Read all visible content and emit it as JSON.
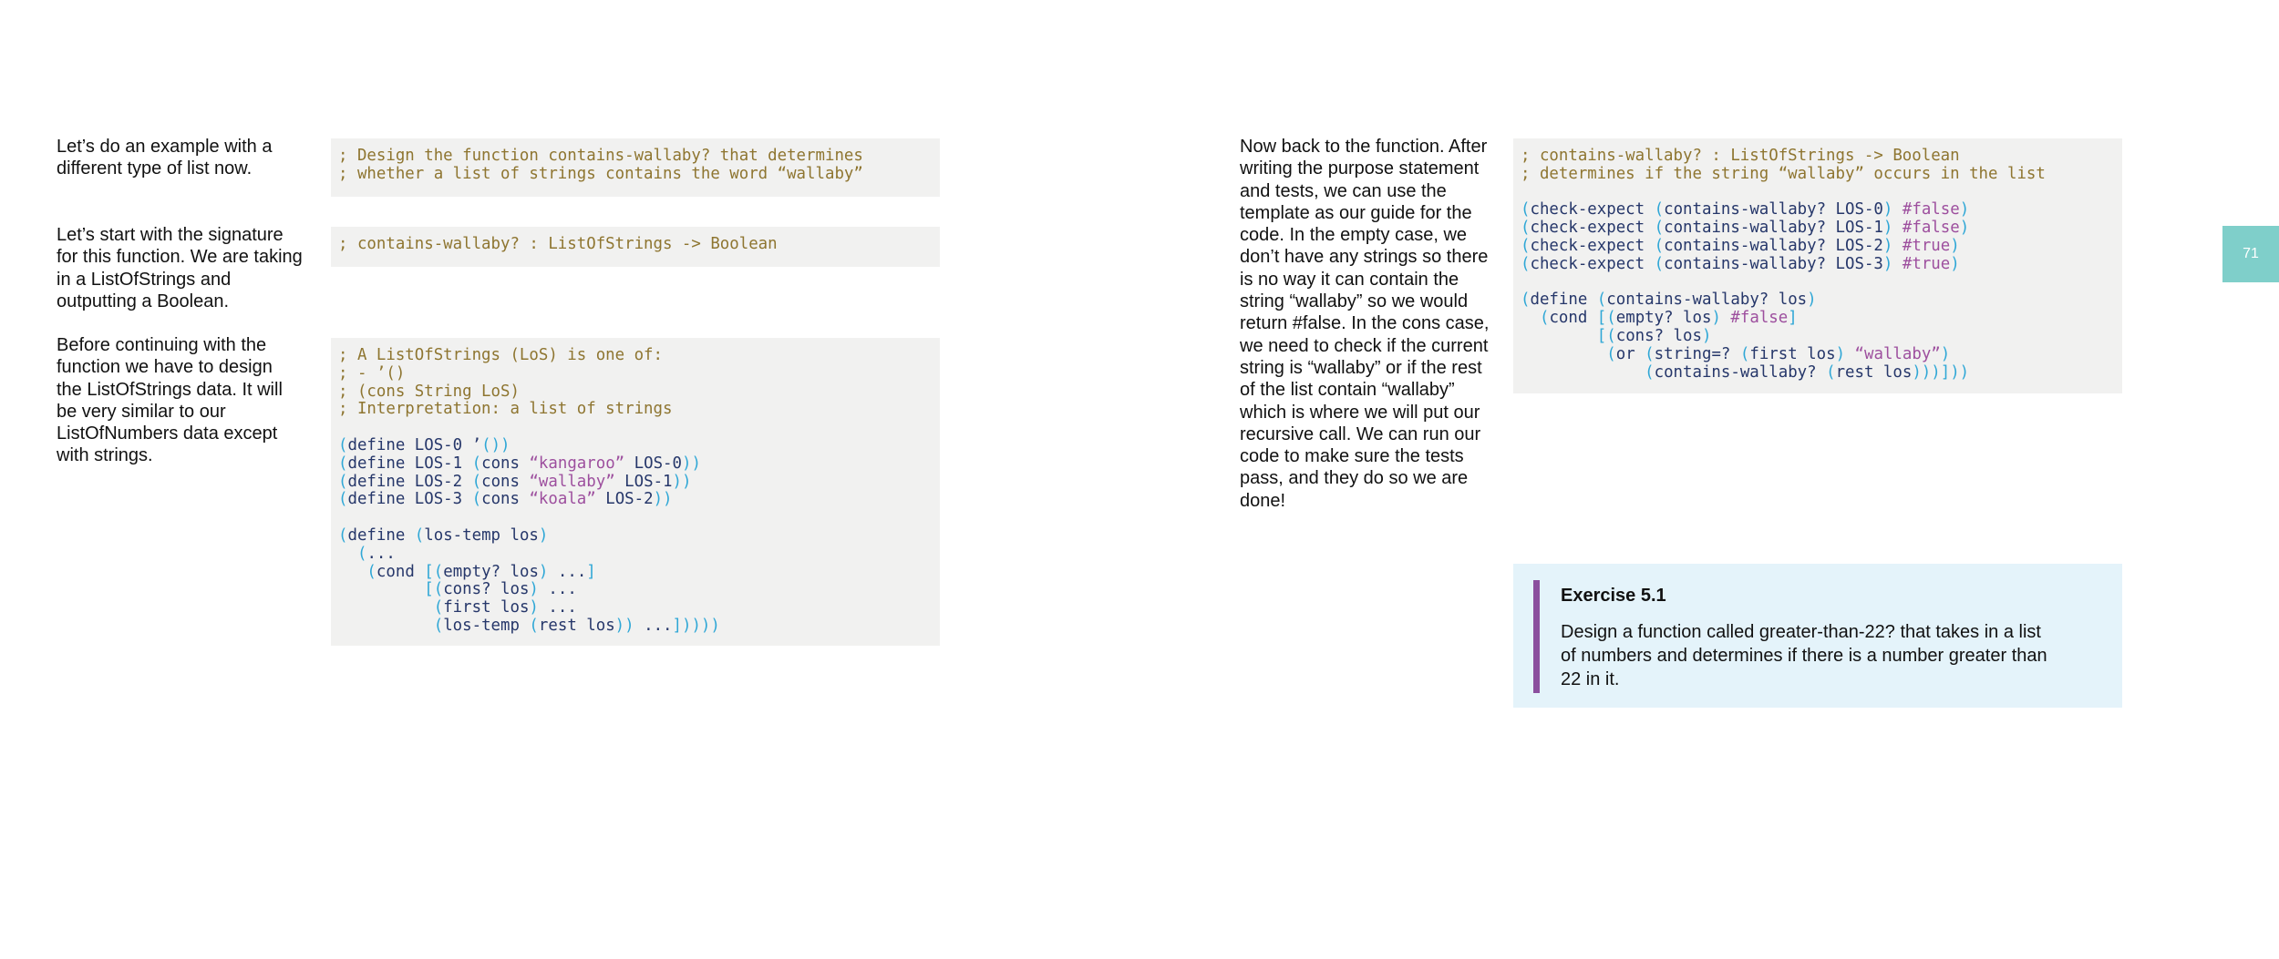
{
  "left": {
    "intro": "Let’s do an example with a different type of list now.",
    "signature_note": "Let’s start with the signature for this function. We are taking in a ListOfStrings and outputting a Boolean.",
    "data_note": "Before continuing with the function we have to design the ListOfStrings data. It will be very similar to our ListOfNumbers data except with strings.",
    "code_design": [
      "; Design the function contains-wallaby? that determines",
      "; whether a list of strings contains the word “wallaby”"
    ],
    "code_signature": "; contains-wallaby? : ListOfStrings -> Boolean",
    "code_data_comments": [
      "; A ListOfStrings (LoS) is one of:",
      "; - ’()",
      "; (cons String LoS)",
      "; Interpretation: a list of strings"
    ],
    "strings": {
      "kangaroo": "“kangaroo”",
      "wallaby": "“wallaby”",
      "koala": "“koala”"
    }
  },
  "right": {
    "body": "Now back to the function. After writing the purpose statement and tests, we can use the template as our guide for the code. In the empty case, we don’t have any strings so there is no way it can contain the string “wallaby” so we would return #false. In the cons case, we need to check if the current string is “wallaby” or if the rest of the list contain “wallaby” which is where we will put our recursive call. We can run our code to make sure the tests pass, and they do so we are done!",
    "code_comments": [
      "; contains-wallaby? : ListOfStrings -> Boolean",
      "; determines if the string “wallaby” occurs in the list"
    ],
    "wallaby_string": "“wallaby”"
  },
  "exercise": {
    "title": "Exercise 5.1",
    "body": "Design a function called greater-than-22? that takes in a list of numbers and determines if there is a number greater than 22 in it."
  },
  "page_number": "71",
  "colors": {
    "code_bg": "#f1f1f0",
    "comment": "#8e7530",
    "keyword": "#26376a",
    "paren": "#2fa7d6",
    "string": "#9d4f9e",
    "exercise_bg": "#e4f3fa",
    "exercise_bar": "#8b4f9e",
    "page_tab": "#7fcfca"
  }
}
